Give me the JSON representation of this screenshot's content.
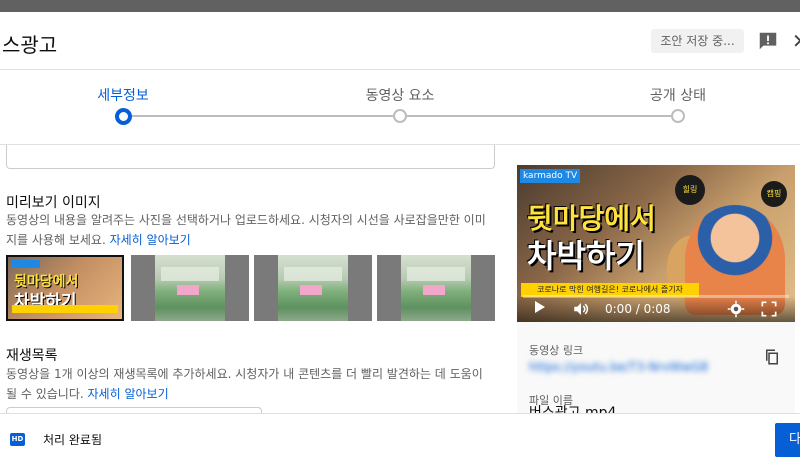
{
  "header": {
    "title": "스광고",
    "save_status": "조안 저장 중..."
  },
  "stepper": {
    "steps": [
      {
        "label": "세부정보",
        "state": "active"
      },
      {
        "label": "동영상 요소",
        "state": "pending"
      },
      {
        "label": "공개 상태",
        "state": "pending"
      }
    ],
    "accent_color": "#065fd4"
  },
  "thumbnail_section": {
    "title": "미리보기 이미지",
    "description": "동영상의 내용을 알려주는 사진을 선택하거나 업로드하세요. 시청자의 시선을 사로잡을만한 이미지를 사용해 보세요.",
    "learn_more": "자세히 알아보기",
    "selected_index": 0,
    "thumb_text_1": "뒷마당에서",
    "thumb_text_2": "차박하기",
    "thumb_brand": "karmado TV"
  },
  "playlist_section": {
    "title": "재생목록",
    "description": "동영상을 1개 이상의 재생목록에 추가하세요. 시청자가 내 콘텐츠를 더 빨리 발견하는 데 도움이 될 수 있습니다.",
    "learn_more": "자세히 알아보기"
  },
  "video_preview": {
    "brand": "karmado TV",
    "headline_1": "뒷마당에서",
    "headline_2": "차박하기",
    "caption": "코로나로 막힌 여행길은! 코로나에서 즐기자",
    "sticker_1": "힐링",
    "sticker_2": "캠핑",
    "time": "0:00 / 0:08",
    "progress": 0
  },
  "video_info": {
    "link_label": "동영상 링크",
    "link_value": "https://youtu.be/T3-NrvWwG8",
    "file_label": "파일 이름",
    "file_name": "버스광고.mp4"
  },
  "footer": {
    "badge": "HD",
    "status": "처리 완료됨",
    "next_label": "다"
  }
}
